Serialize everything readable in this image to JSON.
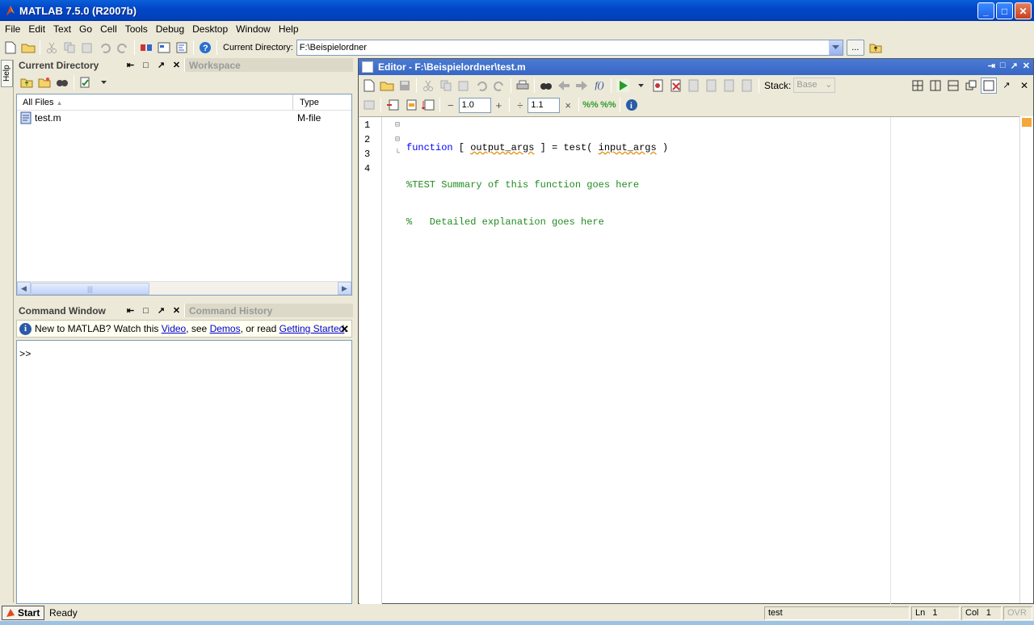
{
  "window": {
    "title": "MATLAB  7.5.0 (R2007b)",
    "btn_min": "_",
    "btn_max": "□",
    "btn_close": "✕"
  },
  "menu": [
    "File",
    "Edit",
    "Text",
    "Go",
    "Cell",
    "Tools",
    "Debug",
    "Desktop",
    "Window",
    "Help"
  ],
  "toolbar": {
    "current_directory_label": "Current Directory:",
    "current_directory_value": "F:\\Beispielordner",
    "browse_label": "..."
  },
  "help_strip": {
    "label": "Help"
  },
  "current_directory_panel": {
    "title": "Current Directory",
    "inactive_tab": "Workspace",
    "columns": [
      "All Files",
      "Type"
    ],
    "files": [
      {
        "name": "test.m",
        "type": "M-file"
      }
    ]
  },
  "command_window": {
    "title": "Command Window",
    "inactive_tab": "Command History",
    "notice_prefix": "New to MATLAB? Watch this ",
    "notice_video": "Video",
    "notice_mid": ", see ",
    "notice_demos": "Demos",
    "notice_or": ", or read ",
    "notice_getting_started": "Getting Started",
    "notice_end": ".",
    "prompt": ">>"
  },
  "editor": {
    "title": "Editor - F:\\Beispielordner\\test.m",
    "stack_label": "Stack:",
    "stack_value": "Base",
    "cell_minus_value": "1.0",
    "cell_divide_value": "1.1",
    "line_numbers": [
      "1",
      "2",
      "3",
      "4"
    ],
    "code": {
      "line1_kw": "function",
      "line1_a": " [ ",
      "line1_out": "output_args",
      "line1_b": " ] = test( ",
      "line1_in": "input_args",
      "line1_c": " )",
      "line2": "%TEST Summary of this function goes here",
      "line3": "%   Detailed explanation goes here"
    }
  },
  "statusbar": {
    "start": "Start",
    "status": "Ready",
    "function": "test",
    "ln_label": "Ln",
    "ln_value": "1",
    "col_label": "Col",
    "col_value": "1",
    "ovr": "OVR"
  }
}
